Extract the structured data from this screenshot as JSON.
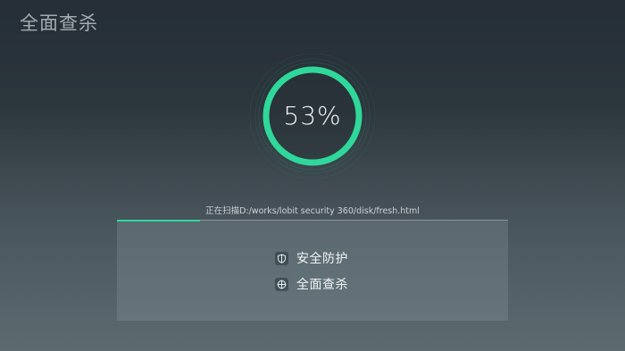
{
  "window": {
    "title": "全面查杀"
  },
  "scan": {
    "progress_percent": 53,
    "progress_label": "53%",
    "current_file_text": "正在扫描D:/works/lobit security 360/disk/fresh.html"
  },
  "menu": {
    "items": [
      {
        "label": "安全防护",
        "icon": "shield-icon"
      },
      {
        "label": "全面查杀",
        "icon": "crosshair-icon"
      }
    ]
  },
  "colors": {
    "accent": "#2fd89a"
  }
}
